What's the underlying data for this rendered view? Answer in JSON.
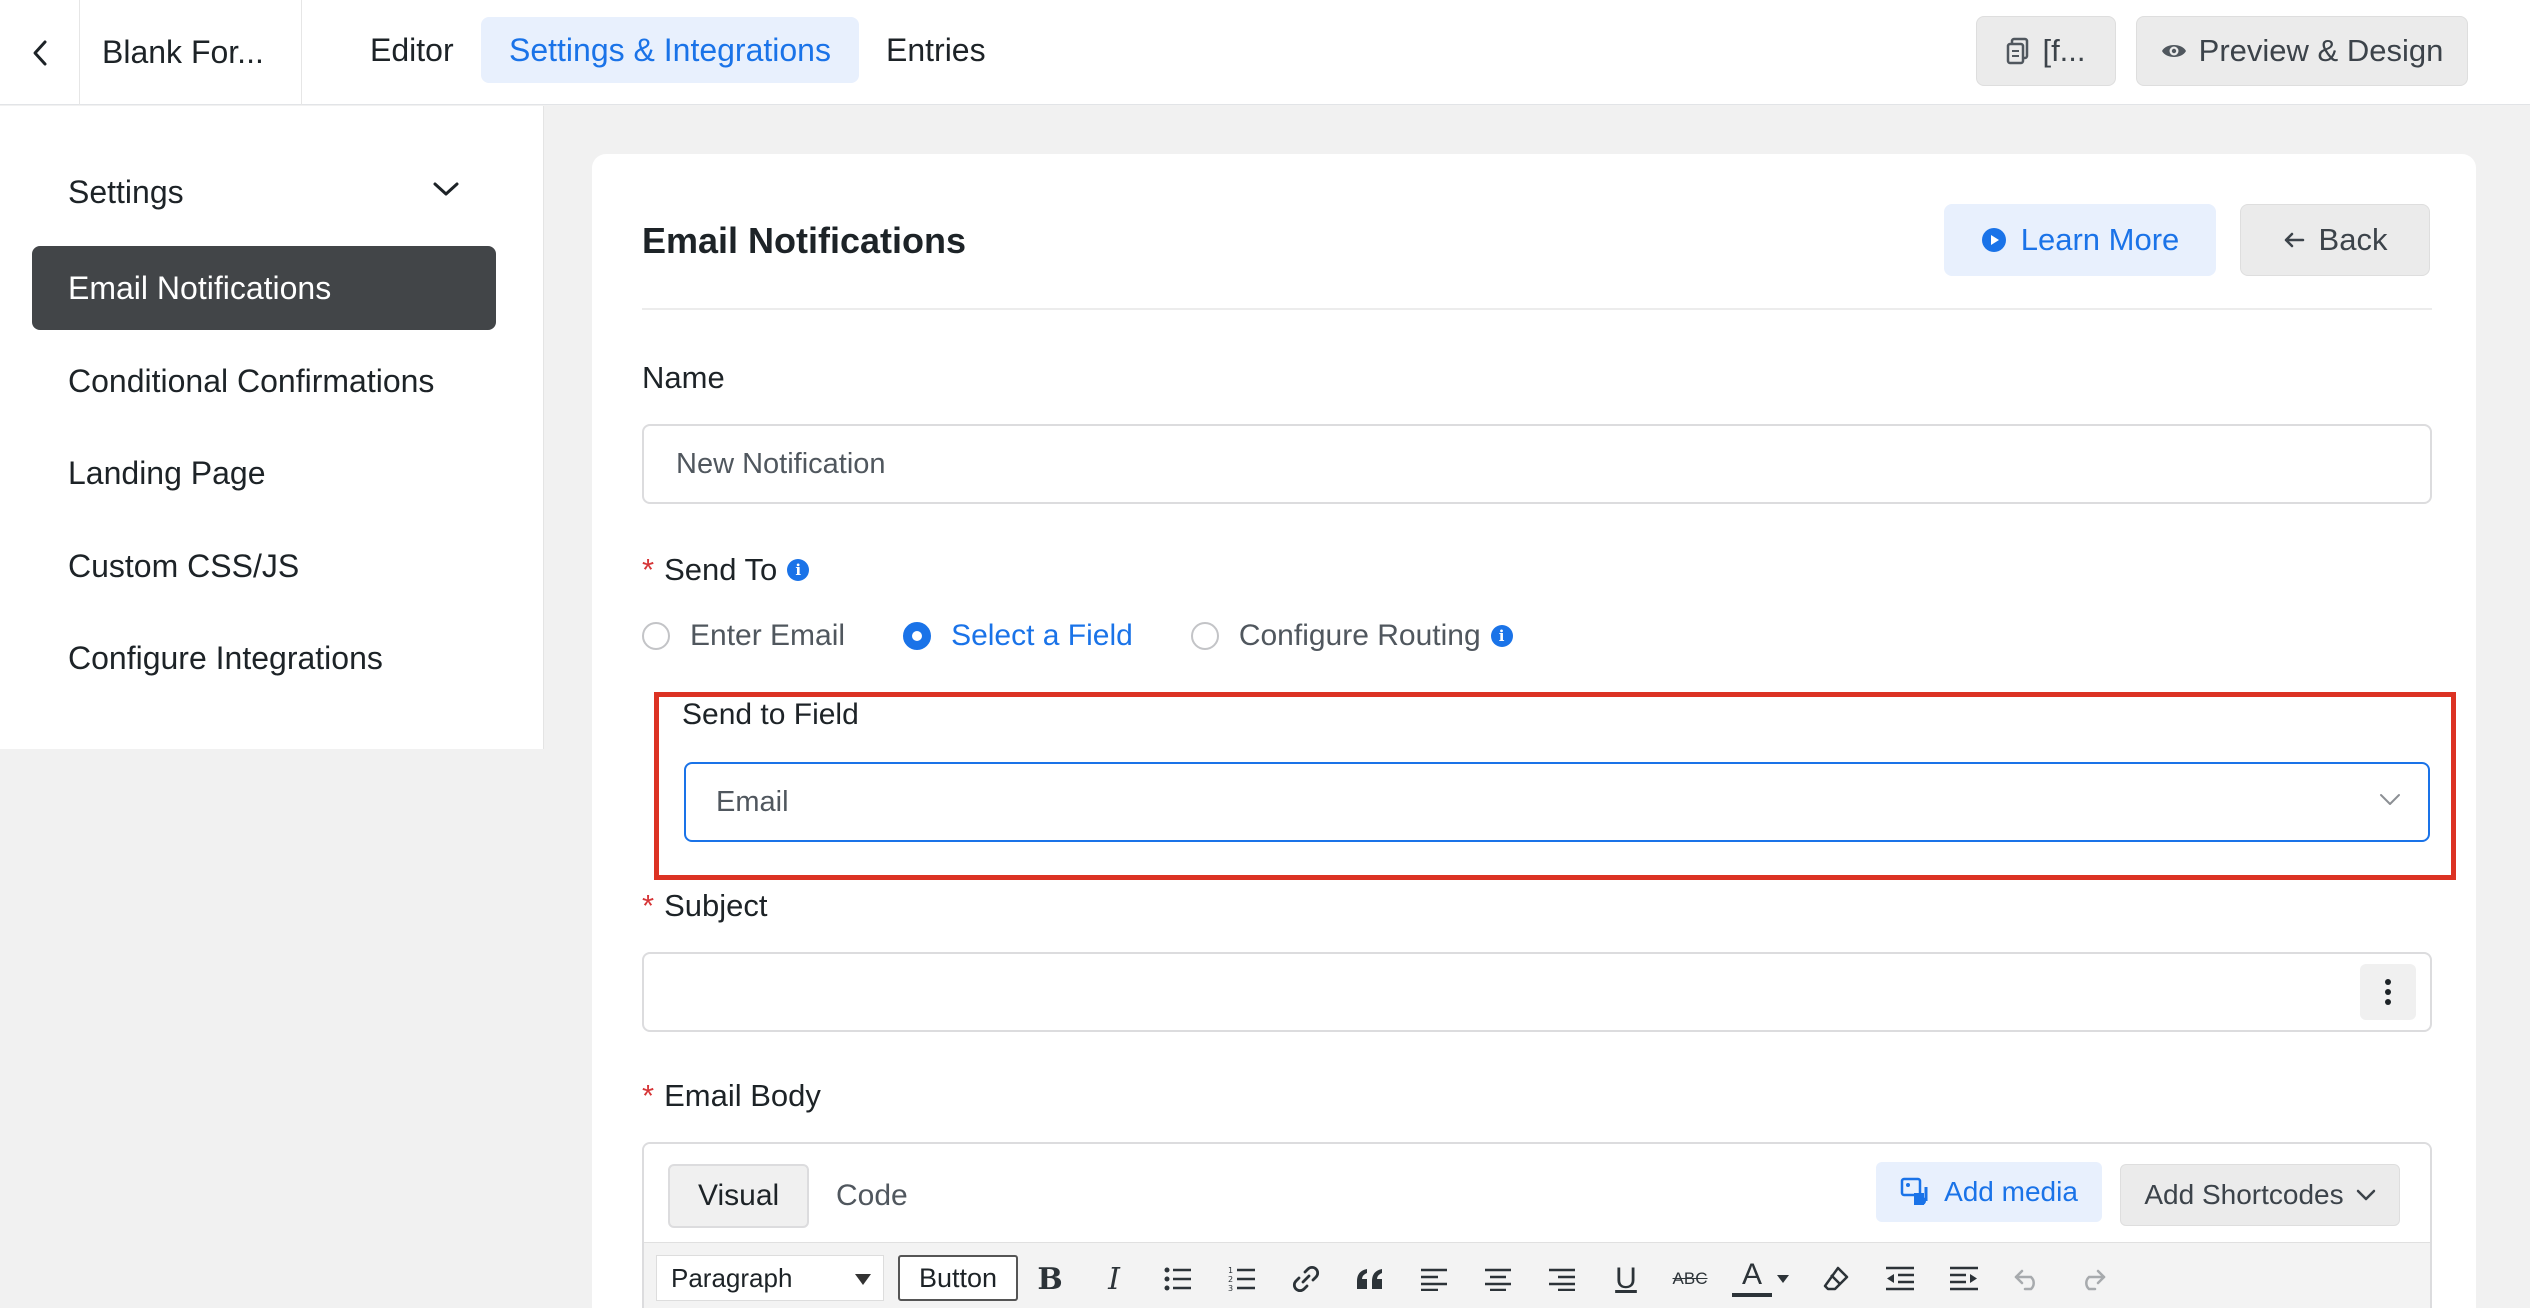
{
  "topbar": {
    "form_title": "Blank For...",
    "tabs": [
      {
        "label": "Editor"
      },
      {
        "label": "Settings & Integrations"
      },
      {
        "label": "Entries"
      }
    ],
    "shortcode_label": "[f...",
    "preview_label": "Preview & Design"
  },
  "sidebar": {
    "settings_label": "Settings",
    "items": [
      {
        "label": "Email Notifications"
      },
      {
        "label": "Conditional Confirmations"
      },
      {
        "label": "Landing Page"
      },
      {
        "label": "Custom CSS/JS"
      },
      {
        "label": "Configure Integrations"
      }
    ]
  },
  "main": {
    "title": "Email Notifications",
    "learn_more": "Learn More",
    "back": "Back",
    "name_label": "Name",
    "name_value": "New Notification",
    "send_to_label": "Send To",
    "required_mark": "*",
    "radios": [
      {
        "label": "Enter Email",
        "selected": false
      },
      {
        "label": "Select a Field",
        "selected": true
      },
      {
        "label": "Configure Routing",
        "selected": false
      }
    ],
    "send_to_field_label": "Send to Field",
    "send_to_field_value": "Email",
    "subject_label": "Subject",
    "subject_value": "",
    "email_body_label": "Email Body",
    "info_glyph": "i",
    "editor": {
      "tab_visual": "Visual",
      "tab_code": "Code",
      "add_media": "Add media",
      "add_shortcodes": "Add Shortcodes",
      "format_select": "Paragraph",
      "button_label": "Button",
      "bold": "B",
      "italic": "I",
      "underline": "U",
      "strike": "ABC",
      "text_color": "A"
    }
  },
  "colors": {
    "accent": "#1a73e8",
    "sidebar_active": "#424548",
    "required": "#d63638",
    "highlight": "#dc3223"
  }
}
